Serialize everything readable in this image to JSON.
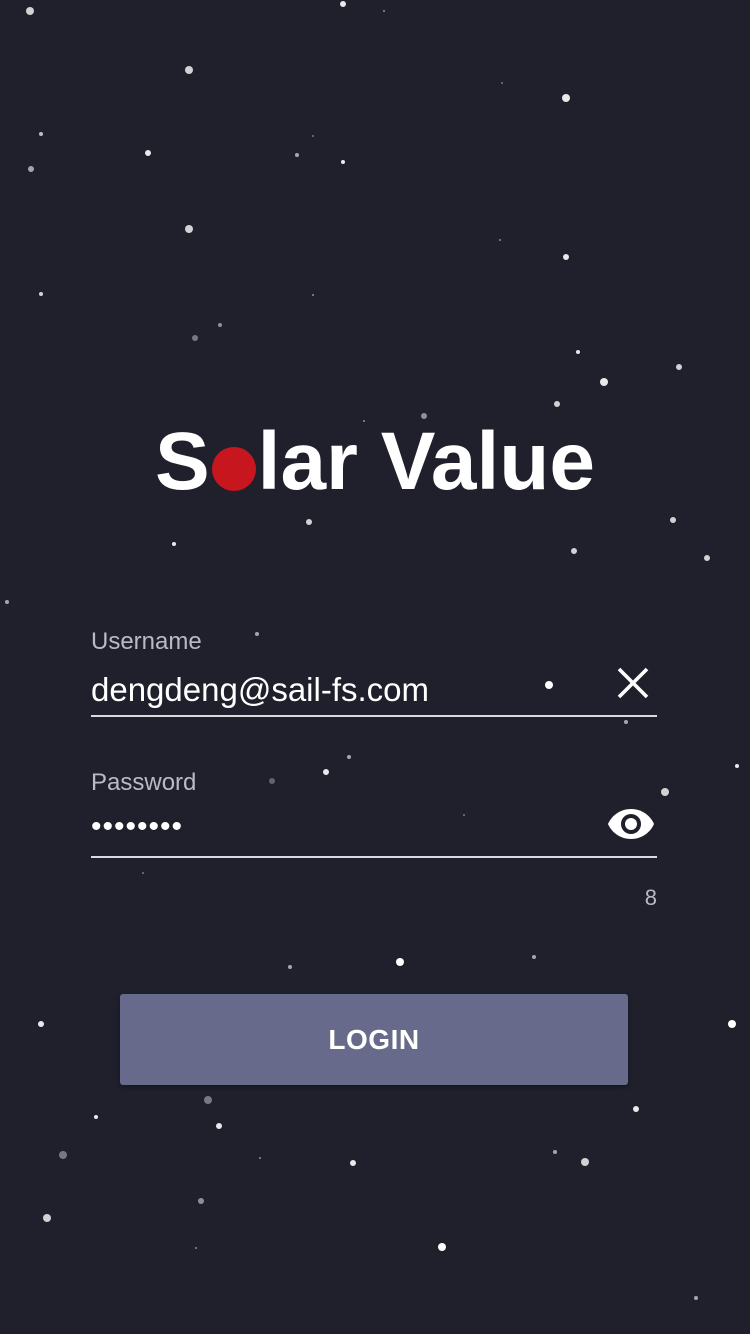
{
  "app": {
    "logo": {
      "part1": "S",
      "part2": "lar Value",
      "dot_color": "#c8161e"
    }
  },
  "login_form": {
    "username": {
      "label": "Username",
      "value": "dengdeng@sail-fs.com",
      "clear_icon": "close-icon"
    },
    "password": {
      "label": "Password",
      "value": "••••••••",
      "visibility_icon": "eye-icon",
      "char_count": "8"
    },
    "login_button": {
      "label": "LOGIN"
    }
  },
  "colors": {
    "background": "#1f202c",
    "button": "#676a8a",
    "accent": "#c8161e"
  }
}
